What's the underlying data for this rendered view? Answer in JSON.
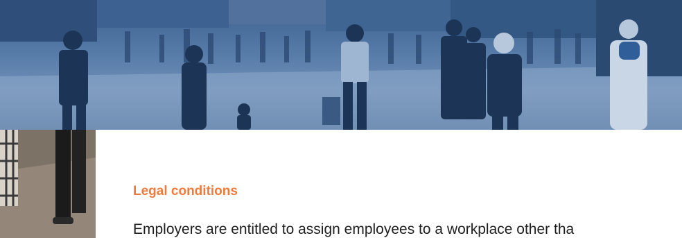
{
  "section": {
    "heading": "Legal conditions",
    "body_start": "Employers are entitled to assign employees to a workplace other tha"
  },
  "colors": {
    "heading": "#ee7a3b",
    "hero_tint": "#4a6d9b",
    "body_text": "#1f1f1f"
  }
}
